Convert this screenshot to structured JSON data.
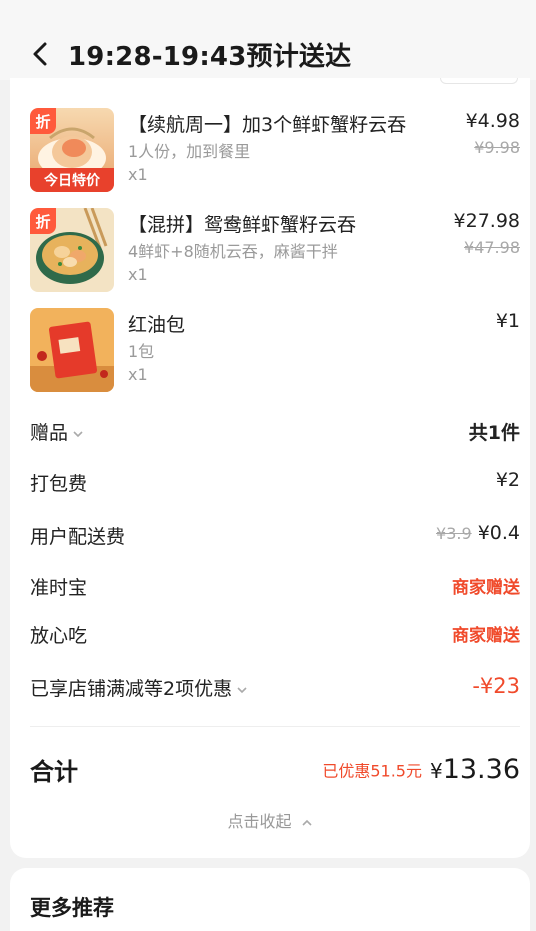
{
  "header": {
    "title": "19:28-19:43预计送达"
  },
  "items": [
    {
      "badge": "折",
      "name": "【续航周一】加3个鲜虾蟹籽云吞",
      "spec": "1人份，加到餐里",
      "qty": "x1",
      "price": "¥4.98",
      "orig": "¥9.98",
      "thumb_text": "今日特价"
    },
    {
      "badge": "折",
      "name": "【混拼】鸳鸯鲜虾蟹籽云吞",
      "spec": "4鲜虾+8随机云吞，麻酱干拌",
      "qty": "x1",
      "price": "¥27.98",
      "orig": "¥47.98"
    },
    {
      "name": "红油包",
      "spec": "1包",
      "qty": "x1",
      "price": "¥1"
    }
  ],
  "rows": {
    "gift": {
      "label": "赠品",
      "value": "共1件"
    },
    "packing": {
      "label": "打包费",
      "value": "¥2"
    },
    "delivery": {
      "label": "用户配送费",
      "orig": "¥3.9",
      "value": "¥0.4"
    },
    "ontime": {
      "label": "准时宝",
      "value": "商家赠送"
    },
    "safe": {
      "label": "放心吃",
      "value": "商家赠送"
    },
    "discount": {
      "label": "已享店铺满减等2项优惠",
      "value": "-¥23"
    }
  },
  "total": {
    "label": "合计",
    "saved": "已优惠51.5元",
    "currency": "¥",
    "amount": "13.36"
  },
  "collapse_label": "点击收起",
  "more": {
    "title": "更多推荐"
  },
  "colors": {
    "accent_red": "#f04a2b",
    "badge_orange": "#ff5a3c"
  }
}
